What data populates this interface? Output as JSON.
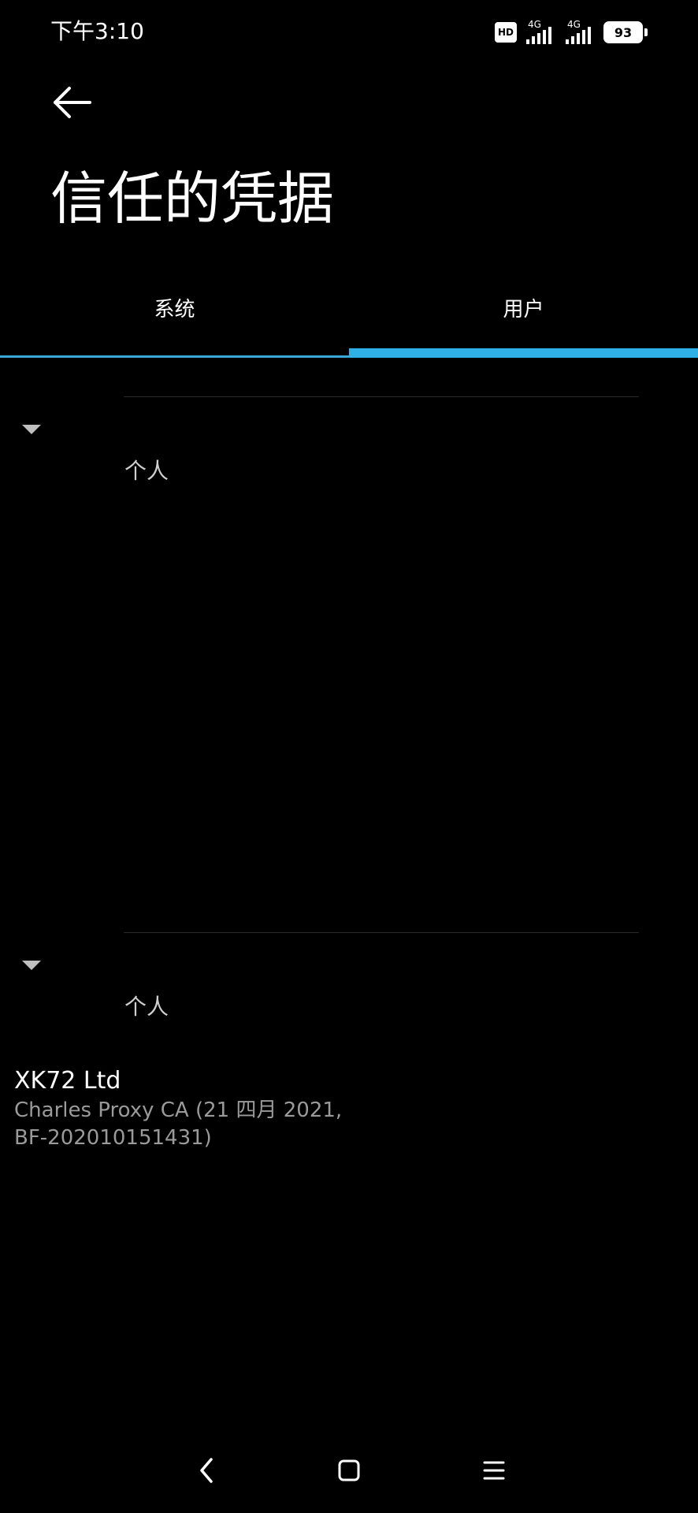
{
  "status_bar": {
    "time": "下午3:10",
    "hd_label": "HD",
    "network_1": "4G",
    "network_2": "4G",
    "battery": "93"
  },
  "header": {
    "title": "信任的凭据"
  },
  "tabs": [
    {
      "label": "系统",
      "selected": false
    },
    {
      "label": "用户",
      "selected": true
    }
  ],
  "accent_color": "#2fb0e6",
  "sections": [
    {
      "label": "个人"
    },
    {
      "label": "个人"
    }
  ],
  "certificate": {
    "organization": "XK72 Ltd",
    "detail_line1": "Charles Proxy CA (21 四月 2021,",
    "detail_line2": "BF-202010151431)"
  },
  "nav_icons": [
    "back-icon",
    "home-icon",
    "menu-icon"
  ]
}
